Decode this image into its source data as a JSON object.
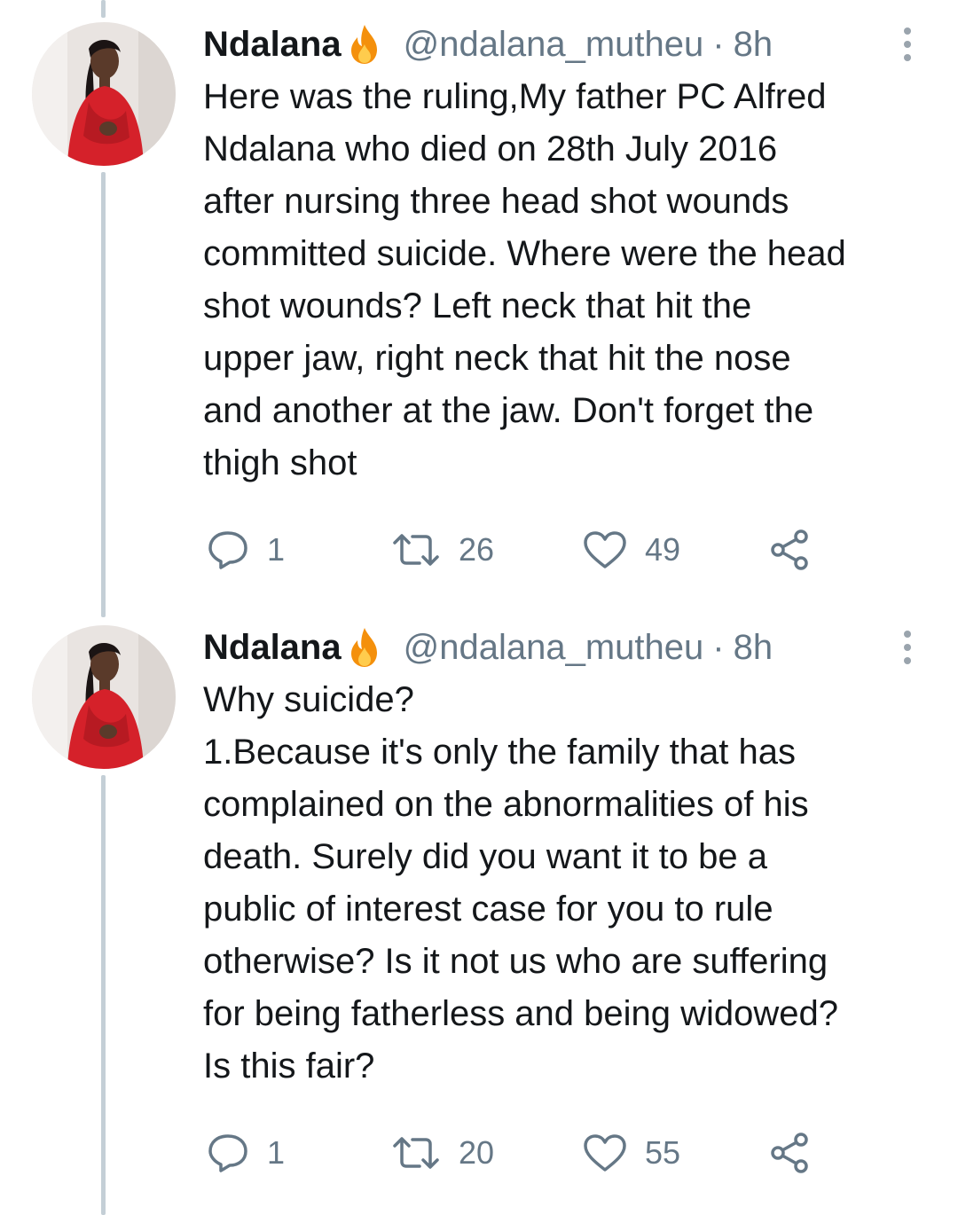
{
  "colors": {
    "text": "#14171a",
    "secondary": "#657786",
    "thread_line": "#c4cfd6",
    "fire": "#f4900c"
  },
  "tweets": [
    {
      "author": {
        "name": "Ndalana",
        "badge_icon": "fire-icon",
        "handle": "@ndalana_mutheu",
        "separator": "·",
        "time": "8h"
      },
      "lines": [
        "Here was the ruling,My father PC Alfred",
        "Ndalana who died on 28th July 2016",
        "after nursing three head shot wounds",
        "committed suicide. Where were the head",
        "shot wounds? Left neck that hit the",
        "upper jaw, right neck that hit the nose",
        "and another at the jaw. Don't forget the",
        "thigh shot"
      ],
      "replies": "1",
      "retweets": "26",
      "likes": "49"
    },
    {
      "author": {
        "name": "Ndalana",
        "badge_icon": "fire-icon",
        "handle": "@ndalana_mutheu",
        "separator": "·",
        "time": "8h"
      },
      "lines": [
        "Why suicide?",
        "1.Because it's only the family that has",
        "complained on the abnormalities of his",
        "death. Surely did you want it to be a",
        "public of interest case for you to rule",
        "otherwise? Is it not us who are suffering",
        "for being fatherless and being widowed?",
        "Is this fair?"
      ],
      "replies": "1",
      "retweets": "20",
      "likes": "55"
    }
  ]
}
